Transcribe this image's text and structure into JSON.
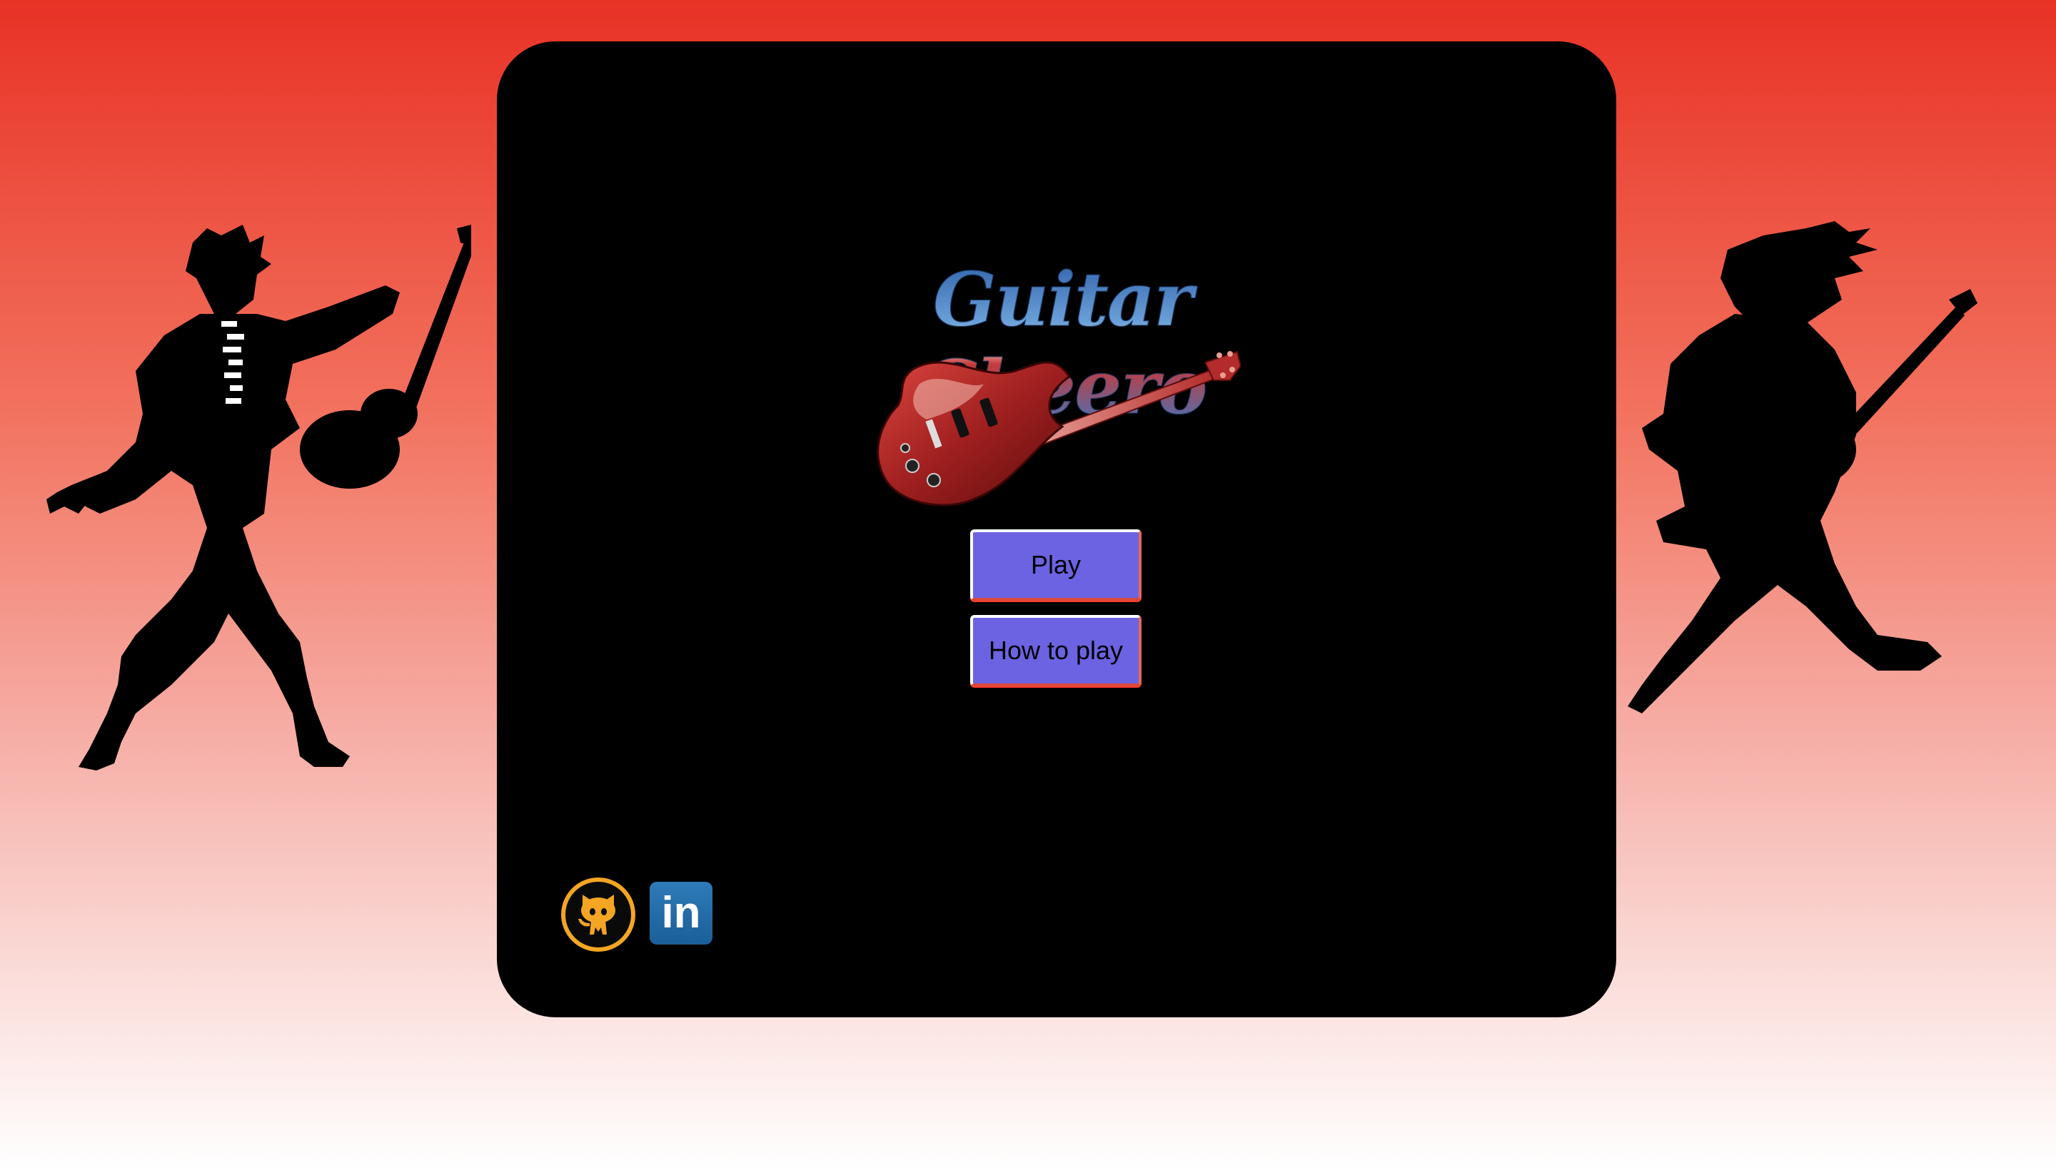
{
  "app": {
    "title": "Guitar Cheero"
  },
  "menu": {
    "play_label": "Play",
    "how_to_play_label": "How to play"
  },
  "social": {
    "github_icon": "github-octocat-icon",
    "linkedin_label": "in"
  },
  "colors": {
    "background_top": "#e83226",
    "background_bottom": "#ffffff",
    "panel": "#000000",
    "button_fill": "#6b63e2",
    "github_ring": "#f3a523",
    "linkedin_blue": "#1a5f98"
  }
}
